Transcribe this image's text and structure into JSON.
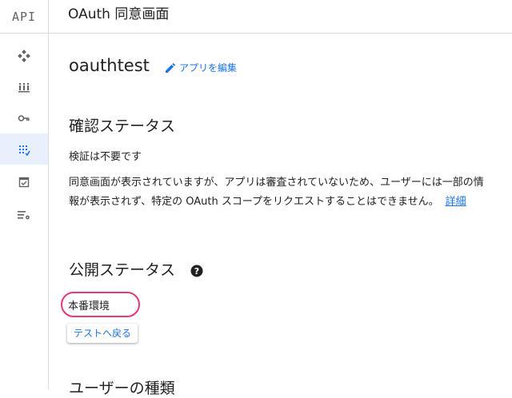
{
  "header": {
    "logo": "API",
    "title": "OAuth 同意画面"
  },
  "sidebar": {
    "items": [
      {
        "icon": "dashboard-icon",
        "active": false
      },
      {
        "icon": "library-icon",
        "active": false
      },
      {
        "icon": "key-icon",
        "active": false
      },
      {
        "icon": "oauth-consent-icon",
        "active": true
      },
      {
        "icon": "domain-verification-icon",
        "active": false
      },
      {
        "icon": "settings-list-icon",
        "active": false
      }
    ]
  },
  "app": {
    "name": "oauthtest",
    "edit_label": "アプリを編集"
  },
  "verification": {
    "title": "確認ステータス",
    "status": "検証は不要です",
    "description": "同意画面が表示されていますが、アプリは審査されていないため、ユーザーには一部の情報が表示されず、特定の OAuth スコープをリクエストすることはできません。",
    "more_link": "詳細"
  },
  "publishing": {
    "title": "公開ステータス",
    "status": "本番環境",
    "back_button": "テストへ戻る"
  },
  "user_type": {
    "title": "ユーザーの種類"
  },
  "colors": {
    "accent": "#1a73e8",
    "highlight": "#e8357e",
    "active_nav_bg": "#e8f0fe"
  }
}
